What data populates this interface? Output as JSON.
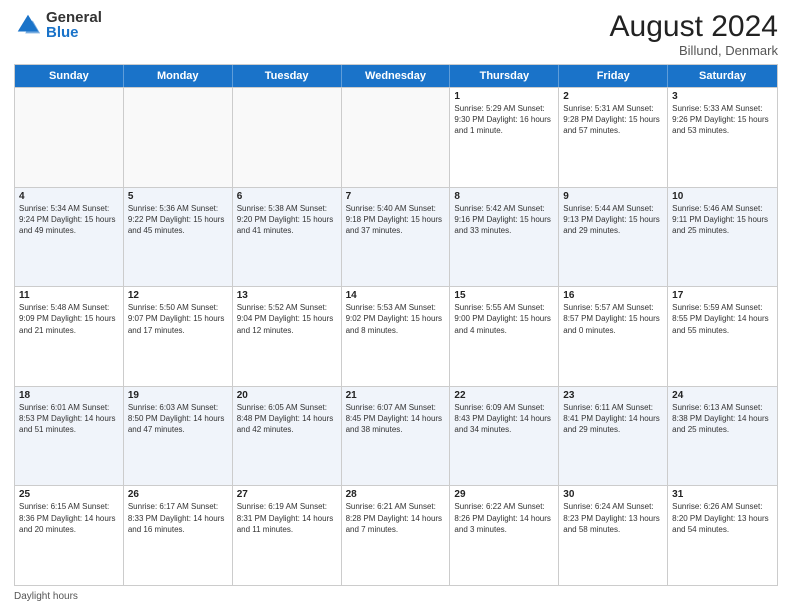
{
  "logo": {
    "general": "General",
    "blue": "Blue"
  },
  "title": "August 2024",
  "location": "Billund, Denmark",
  "days": [
    "Sunday",
    "Monday",
    "Tuesday",
    "Wednesday",
    "Thursday",
    "Friday",
    "Saturday"
  ],
  "footer": "Daylight hours",
  "weeks": [
    [
      {
        "day": "",
        "text": "",
        "empty": true
      },
      {
        "day": "",
        "text": "",
        "empty": true
      },
      {
        "day": "",
        "text": "",
        "empty": true
      },
      {
        "day": "",
        "text": "",
        "empty": true
      },
      {
        "day": "1",
        "text": "Sunrise: 5:29 AM\nSunset: 9:30 PM\nDaylight: 16 hours\nand 1 minute."
      },
      {
        "day": "2",
        "text": "Sunrise: 5:31 AM\nSunset: 9:28 PM\nDaylight: 15 hours\nand 57 minutes."
      },
      {
        "day": "3",
        "text": "Sunrise: 5:33 AM\nSunset: 9:26 PM\nDaylight: 15 hours\nand 53 minutes."
      }
    ],
    [
      {
        "day": "4",
        "text": "Sunrise: 5:34 AM\nSunset: 9:24 PM\nDaylight: 15 hours\nand 49 minutes."
      },
      {
        "day": "5",
        "text": "Sunrise: 5:36 AM\nSunset: 9:22 PM\nDaylight: 15 hours\nand 45 minutes."
      },
      {
        "day": "6",
        "text": "Sunrise: 5:38 AM\nSunset: 9:20 PM\nDaylight: 15 hours\nand 41 minutes."
      },
      {
        "day": "7",
        "text": "Sunrise: 5:40 AM\nSunset: 9:18 PM\nDaylight: 15 hours\nand 37 minutes."
      },
      {
        "day": "8",
        "text": "Sunrise: 5:42 AM\nSunset: 9:16 PM\nDaylight: 15 hours\nand 33 minutes."
      },
      {
        "day": "9",
        "text": "Sunrise: 5:44 AM\nSunset: 9:13 PM\nDaylight: 15 hours\nand 29 minutes."
      },
      {
        "day": "10",
        "text": "Sunrise: 5:46 AM\nSunset: 9:11 PM\nDaylight: 15 hours\nand 25 minutes."
      }
    ],
    [
      {
        "day": "11",
        "text": "Sunrise: 5:48 AM\nSunset: 9:09 PM\nDaylight: 15 hours\nand 21 minutes."
      },
      {
        "day": "12",
        "text": "Sunrise: 5:50 AM\nSunset: 9:07 PM\nDaylight: 15 hours\nand 17 minutes."
      },
      {
        "day": "13",
        "text": "Sunrise: 5:52 AM\nSunset: 9:04 PM\nDaylight: 15 hours\nand 12 minutes."
      },
      {
        "day": "14",
        "text": "Sunrise: 5:53 AM\nSunset: 9:02 PM\nDaylight: 15 hours\nand 8 minutes."
      },
      {
        "day": "15",
        "text": "Sunrise: 5:55 AM\nSunset: 9:00 PM\nDaylight: 15 hours\nand 4 minutes."
      },
      {
        "day": "16",
        "text": "Sunrise: 5:57 AM\nSunset: 8:57 PM\nDaylight: 15 hours\nand 0 minutes."
      },
      {
        "day": "17",
        "text": "Sunrise: 5:59 AM\nSunset: 8:55 PM\nDaylight: 14 hours\nand 55 minutes."
      }
    ],
    [
      {
        "day": "18",
        "text": "Sunrise: 6:01 AM\nSunset: 8:53 PM\nDaylight: 14 hours\nand 51 minutes."
      },
      {
        "day": "19",
        "text": "Sunrise: 6:03 AM\nSunset: 8:50 PM\nDaylight: 14 hours\nand 47 minutes."
      },
      {
        "day": "20",
        "text": "Sunrise: 6:05 AM\nSunset: 8:48 PM\nDaylight: 14 hours\nand 42 minutes."
      },
      {
        "day": "21",
        "text": "Sunrise: 6:07 AM\nSunset: 8:45 PM\nDaylight: 14 hours\nand 38 minutes."
      },
      {
        "day": "22",
        "text": "Sunrise: 6:09 AM\nSunset: 8:43 PM\nDaylight: 14 hours\nand 34 minutes."
      },
      {
        "day": "23",
        "text": "Sunrise: 6:11 AM\nSunset: 8:41 PM\nDaylight: 14 hours\nand 29 minutes."
      },
      {
        "day": "24",
        "text": "Sunrise: 6:13 AM\nSunset: 8:38 PM\nDaylight: 14 hours\nand 25 minutes."
      }
    ],
    [
      {
        "day": "25",
        "text": "Sunrise: 6:15 AM\nSunset: 8:36 PM\nDaylight: 14 hours\nand 20 minutes."
      },
      {
        "day": "26",
        "text": "Sunrise: 6:17 AM\nSunset: 8:33 PM\nDaylight: 14 hours\nand 16 minutes."
      },
      {
        "day": "27",
        "text": "Sunrise: 6:19 AM\nSunset: 8:31 PM\nDaylight: 14 hours\nand 11 minutes."
      },
      {
        "day": "28",
        "text": "Sunrise: 6:21 AM\nSunset: 8:28 PM\nDaylight: 14 hours\nand 7 minutes."
      },
      {
        "day": "29",
        "text": "Sunrise: 6:22 AM\nSunset: 8:26 PM\nDaylight: 14 hours\nand 3 minutes."
      },
      {
        "day": "30",
        "text": "Sunrise: 6:24 AM\nSunset: 8:23 PM\nDaylight: 13 hours\nand 58 minutes."
      },
      {
        "day": "31",
        "text": "Sunrise: 6:26 AM\nSunset: 8:20 PM\nDaylight: 13 hours\nand 54 minutes."
      }
    ]
  ]
}
